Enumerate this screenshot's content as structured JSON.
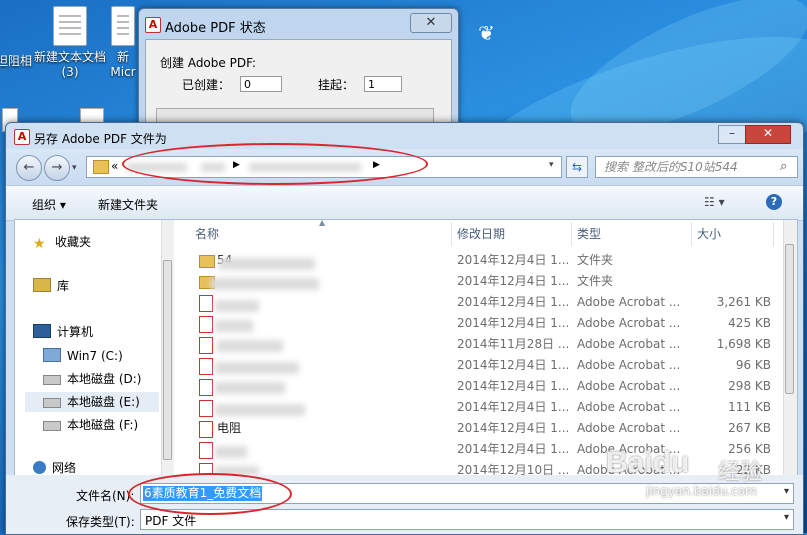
{
  "desktop": {
    "icons": [
      {
        "label": "坦阻相"
      },
      {
        "label": "新建文本文档"
      },
      {
        "label": "(3)"
      },
      {
        "label": "Micr"
      },
      {
        "label": "新"
      }
    ]
  },
  "progress_window": {
    "title": "Adobe PDF 状态",
    "close_label": "✕",
    "section_label": "创建 Adobe PDF:",
    "created_label": "已创建：",
    "created_value": "0",
    "pending_label": "挂起：",
    "pending_value": "1"
  },
  "save_dialog": {
    "title": "另存 Adobe PDF 文件为",
    "close_label": "✕",
    "address": {
      "prefix": "«"
    },
    "search": {
      "placeholder": "搜索 整改后的S10站544"
    },
    "toolbar": {
      "organize": "组织 ▾",
      "new_folder": "新建文件夹",
      "view_glyph": "☷ ▾",
      "help": "?"
    },
    "nav": {
      "favorites": "收藏夹",
      "libraries": "库",
      "computer": "计算机",
      "drives": [
        "Win7 (C:)",
        "本地磁盘 (D:)",
        "本地磁盘 (E:)",
        "本地磁盘 (F:)"
      ],
      "network": "网络"
    },
    "columns": {
      "name": "名称",
      "date": "修改日期",
      "type": "类型",
      "size": "大小"
    },
    "rows": [
      {
        "name": "54",
        "date": "2014年12月4日 1...",
        "type": "文件夹",
        "size": ""
      },
      {
        "name": "",
        "date": "2014年12月4日 1...",
        "type": "文件夹",
        "size": ""
      },
      {
        "name": "",
        "date": "2014年12月4日 1...",
        "type": "Adobe Acrobat ...",
        "size": "3,261 KB"
      },
      {
        "name": "",
        "date": "2014年12月4日 1...",
        "type": "Adobe Acrobat ...",
        "size": "425 KB"
      },
      {
        "name": "",
        "date": "2014年11月28日 ...",
        "type": "Adobe Acrobat ...",
        "size": "1,698 KB"
      },
      {
        "name": "",
        "date": "2014年12月4日 1...",
        "type": "Adobe Acrobat ...",
        "size": "96 KB"
      },
      {
        "name": "",
        "date": "2014年12月4日 1...",
        "type": "Adobe Acrobat ...",
        "size": "298 KB"
      },
      {
        "name": "",
        "date": "2014年12月4日 1...",
        "type": "Adobe Acrobat ...",
        "size": "111 KB"
      },
      {
        "name": "电阻",
        "date": "2014年12月4日 1...",
        "type": "Adobe Acrobat ...",
        "size": "267 KB"
      },
      {
        "name": "",
        "date": "2014年12月4日 1...",
        "type": "Adobe Acrobat ...",
        "size": "256 KB"
      },
      {
        "name": "",
        "date": "2014年12月10日 ...",
        "type": "Adobe Acrobat ...",
        "size": "22 KB"
      }
    ],
    "filename_label": "文件名(N):",
    "filename_value": "6素质教育1_免费文档",
    "filetype_label": "保存类型(T):",
    "filetype_value": "PDF 文件"
  },
  "watermark": {
    "brand": "Baidu",
    "suffix": "经验",
    "sub": "jingyan.baidu.com"
  }
}
